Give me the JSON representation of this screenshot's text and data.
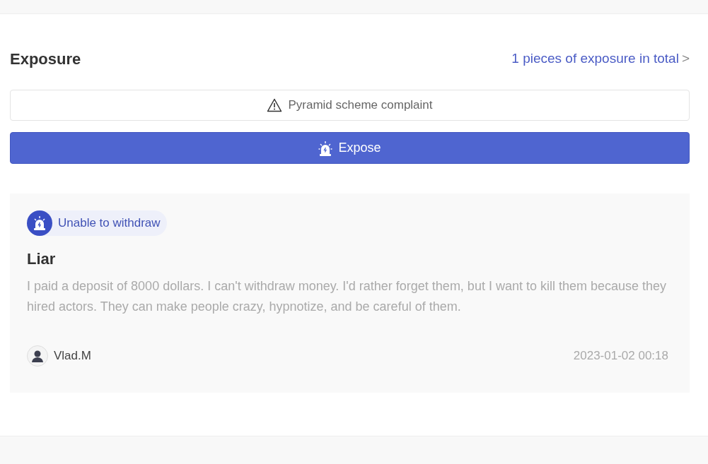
{
  "section": {
    "title": "Exposure",
    "total_link": "1 pieces of exposure in total",
    "total_arrow": ">"
  },
  "complaint_button": {
    "label": "Pyramid scheme complaint"
  },
  "expose_button": {
    "label": "Expose"
  },
  "posts": [
    {
      "tag": "Unable to withdraw",
      "title": "Liar",
      "body": "I paid a deposit of 8000 dollars. I can't withdraw money. I'd rather forget them, but I want to kill them because they hired actors. They can make people crazy, hypnotize, and be careful of them.",
      "author": "Vlad.M",
      "date": "2023-01-02 00:18"
    }
  ]
}
